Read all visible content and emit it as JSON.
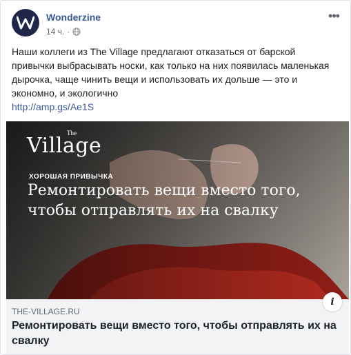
{
  "post": {
    "page_name": "Wonderzine",
    "timestamp": "14 ч.",
    "separator": "·",
    "text": "Наши коллеги из The Village предлагают отказаться от барской привычки выбрасывать носки, как только на них появилась маленькая дырочка, чаще чинить вещи и использовать их дольше — это и экономно, и экологично",
    "link": "http://amp.gs/Ae1S",
    "more_icon": "•••"
  },
  "preview": {
    "brand_logo": "Village",
    "brand_logo_sup": "The",
    "tag": "ХОРОШАЯ ПРИВЫЧКА",
    "overlay_title": "Ремонтировать вещи вместо того, чтобы отправлять их на свалку",
    "info_icon": "i",
    "domain": "THE-VILLAGE.RU",
    "title": "Ремонтировать вещи вместо того, чтобы отправлять их на свалку"
  },
  "icons": {
    "avatar": "wonderzine-w-logo",
    "globe": "globe-icon",
    "more": "more-icon",
    "info": "info-icon"
  },
  "colors": {
    "link": "#385898",
    "avatar_bg": "#1f2648",
    "caption_bg": "#f2f3f5"
  }
}
